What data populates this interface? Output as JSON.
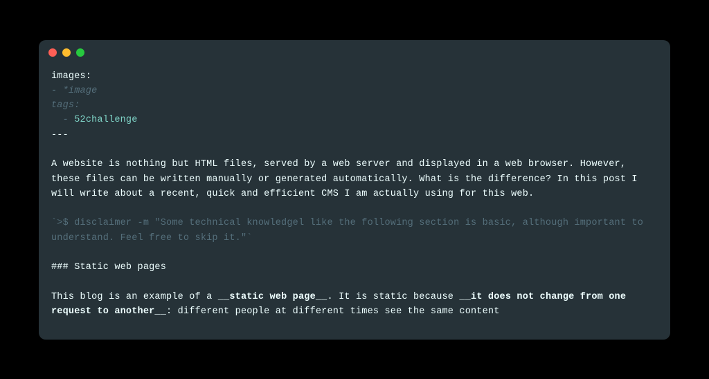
{
  "window": {
    "traffic_lights": [
      "close",
      "minimize",
      "maximize"
    ]
  },
  "code": {
    "line1": "images:",
    "line2_prefix": "- ",
    "line2_star": "*image",
    "line3": "tags:",
    "line4_indent": "  - ",
    "line4_tag": "52challenge",
    "line5": "---",
    "blank1": "",
    "paragraph1": "A website is nothing but HTML files, served by a web server and displayed in a web browser. However, these files can be written manually or generated automatically. What is the difference? In this post I will write about a recent, quick and efficient CMS I am actually using for this web.",
    "blank2": "",
    "disclaimer": "`>$ disclaimer -m \"Some technical knowledgel like the following section is basic, although important to understand. Feel free to skip it.\"`",
    "blank3": "",
    "heading": "### Static web pages",
    "blank4": "",
    "p2_a": "This blog is an example of a ",
    "p2_b": "__static web page__",
    "p2_c": ". It is static because ",
    "p2_d": "__it does not change from one request to another__",
    "p2_e": ": different people at different times see the same content"
  }
}
